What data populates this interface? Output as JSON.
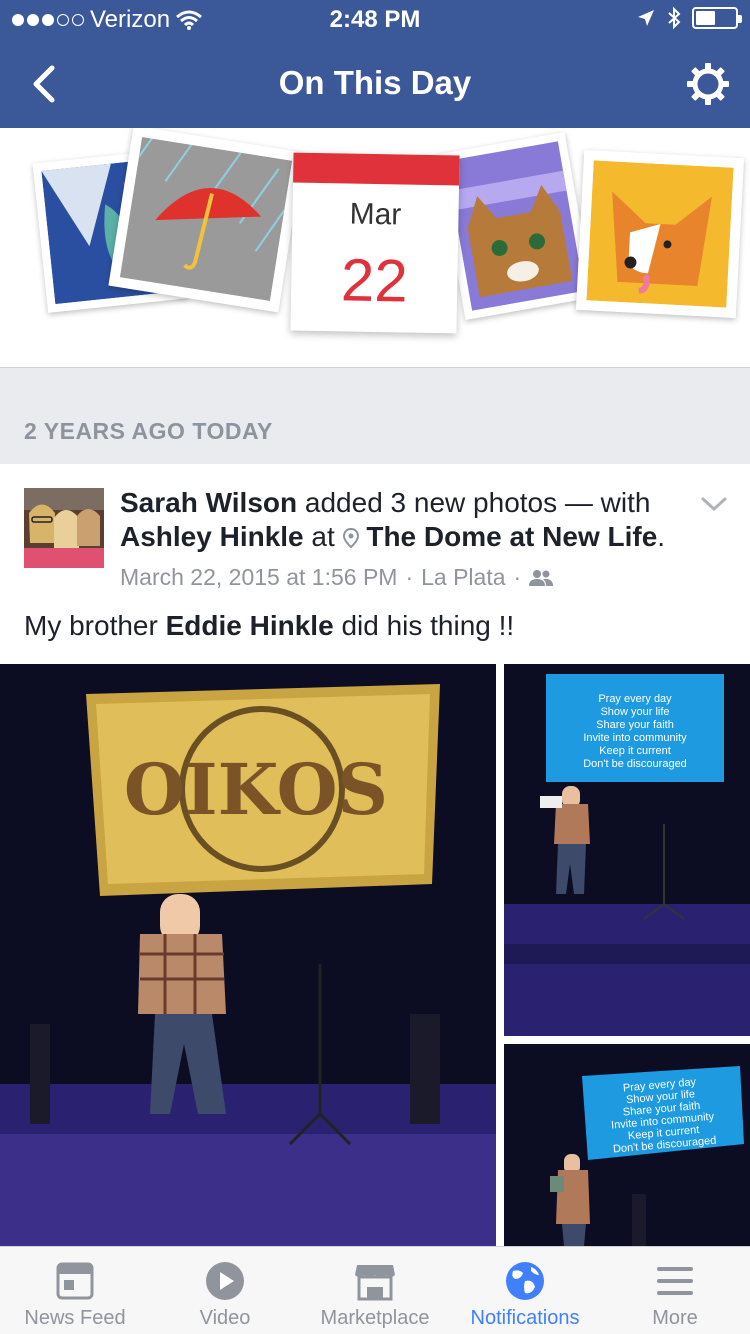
{
  "status_bar": {
    "carrier": "Verizon",
    "time": "2:48 PM",
    "signal_bars": 3,
    "battery_level": 0.5
  },
  "nav": {
    "title": "On This Day",
    "back_icon": "back-chevron-icon",
    "settings_icon": "gear-icon"
  },
  "banner": {
    "calendar_month": "Mar",
    "calendar_day": "22"
  },
  "section_label": "2 YEARS AGO TODAY",
  "post": {
    "author": "Sarah Wilson",
    "action": "added 3 new photos — with",
    "tagged": "Ashley Hinkle",
    "at_word": "at",
    "place": "The Dome at New Life",
    "period": ".",
    "date": "March 22, 2015 at 1:56 PM",
    "separator": "·",
    "location": "La Plata",
    "privacy_icon": "friends-icon",
    "message_prefix": "My brother",
    "message_mention": "Eddie Hinkle",
    "message_suffix": "did his thing !!",
    "photo_screen_text": [
      "Pray every day",
      "Show your life",
      "Share your faith",
      "Invite into community",
      "Keep it current",
      "Don't be discouraged"
    ],
    "photo1_screen_text": "OIKOS"
  },
  "tabs": [
    {
      "label": "News Feed",
      "icon": "news-feed-icon",
      "active": false
    },
    {
      "label": "Video",
      "icon": "video-play-icon",
      "active": false
    },
    {
      "label": "Marketplace",
      "icon": "marketplace-shop-icon",
      "active": false
    },
    {
      "label": "Notifications",
      "icon": "globe-icon",
      "active": true
    },
    {
      "label": "More",
      "icon": "menu-icon",
      "active": false
    }
  ],
  "colors": {
    "brand_blue": "#3b5998",
    "active_tab": "#4080ff",
    "calendar_red": "#e0323b",
    "section_bg": "#e9ebee"
  }
}
